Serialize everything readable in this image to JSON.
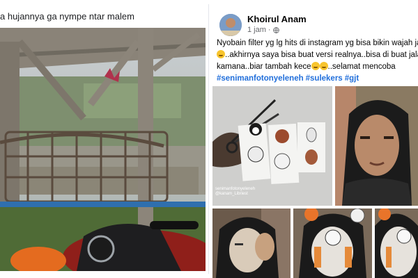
{
  "left_post": {
    "caption": "a hujannya ga nympe ntar malem"
  },
  "right_post": {
    "author": "Khoirul Anam",
    "time": "1 jam",
    "separator": "·",
    "body_lines": [
      "Nyobain filter yg lg hits di instagram yg bisa bikin wajah jadi p",
      "..akhirnya saya bisa buat versi realnya..bisa di buat jalan ke",
      "kamana..biar tambah kece",
      "..selamat mencoba"
    ],
    "hashtags": [
      "#senimanfotonyeleneh",
      "#sulekers",
      "#gjt"
    ],
    "photo_watermark": "senimanfotonyeleneh\n@kanam_Libriest"
  },
  "colors": {
    "hashtag": "#216fdb",
    "meta_text": "#65676b",
    "divider": "#e4e6eb"
  },
  "icons": {
    "privacy": "globe-icon",
    "emoji": "grinning-face-emoji"
  }
}
